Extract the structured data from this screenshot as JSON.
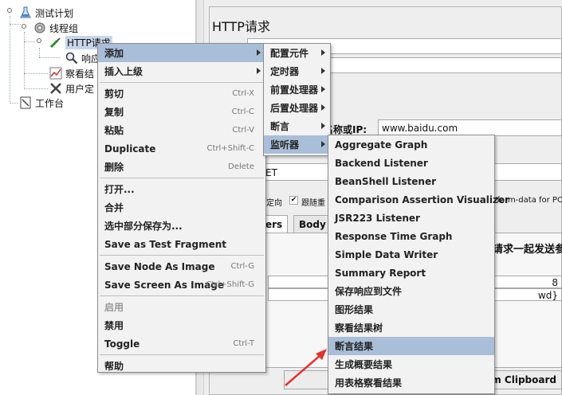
{
  "tree": {
    "test_plan": "测试计划",
    "thread_group": "线程组",
    "http_request": "HTTP请求",
    "child_response": "响应",
    "view_results": "察看结",
    "user_defined": "用户定",
    "workbench": "工作台"
  },
  "panel": {
    "title": "HTTP请求",
    "server_label": "名称或IP:",
    "server_value": "www.baidu.com",
    "method_value": "ET",
    "redirect_text": "定向",
    "follow_redirect_text": "跟随重",
    "multipart_text": "/form-data for POS",
    "tab_headers": "ers",
    "tab_body": "Body D",
    "send_params_text": "请求一起发送参",
    "value_8": "8",
    "value_wd": "wd}",
    "clipboard_btn": "om Clipboard"
  },
  "context_menu": {
    "items": [
      {
        "label": "添加",
        "shortcut": "",
        "submenu": true
      },
      {
        "label": "插入上级",
        "shortcut": "",
        "submenu": true
      },
      {
        "label": "剪切",
        "shortcut": "Ctrl-X"
      },
      {
        "label": "复制",
        "shortcut": "Ctrl-C"
      },
      {
        "label": "粘贴",
        "shortcut": "Ctrl-V"
      },
      {
        "label": "Duplicate",
        "shortcut": "Ctrl+Shift-C"
      },
      {
        "label": "删除",
        "shortcut": "Delete"
      },
      {
        "label": "打开...",
        "shortcut": ""
      },
      {
        "label": "合并",
        "shortcut": ""
      },
      {
        "label": "选中部分保存为...",
        "shortcut": ""
      },
      {
        "label": "Save as Test Fragment",
        "shortcut": ""
      },
      {
        "label": "Save Node As Image",
        "shortcut": "Ctrl-G"
      },
      {
        "label": "Save Screen As Image",
        "shortcut": "Ctrl+Shift-G"
      },
      {
        "label": "启用",
        "shortcut": ""
      },
      {
        "label": "禁用",
        "shortcut": ""
      },
      {
        "label": "Toggle",
        "shortcut": "Ctrl-T"
      },
      {
        "label": "帮助",
        "shortcut": ""
      }
    ]
  },
  "add_submenu": {
    "items": [
      "配置元件",
      "定时器",
      "前置处理器",
      "后置处理器",
      "断言",
      "监听器"
    ]
  },
  "listener_submenu": {
    "items": [
      "Aggregate Graph",
      "Backend Listener",
      "BeanShell Listener",
      "Comparison Assertion Visualizer",
      "JSR223 Listener",
      "Response Time Graph",
      "Simple Data Writer",
      "Summary Report",
      "保存响应到文件",
      "图形结果",
      "察看结果树",
      "断言结果",
      "生成概要结果",
      "用表格察看结果"
    ],
    "highlighted": "断言结果"
  },
  "colors": {
    "menu_bg": "#f2f2f2",
    "highlight": "#a9bed8",
    "annotation_arrow": "#e53030"
  }
}
